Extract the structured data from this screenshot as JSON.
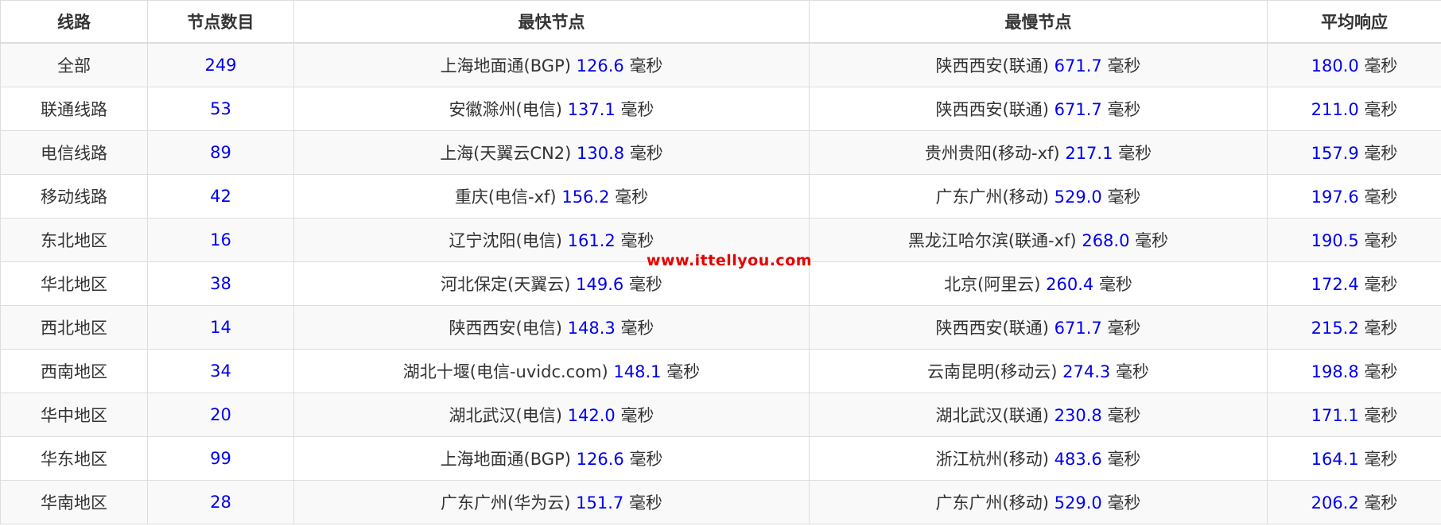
{
  "colors": {
    "value_blue": "#0000ee",
    "text": "#333333",
    "watermark_red": "#e60000",
    "stripe": "#f9f9f9"
  },
  "headers": [
    "线路",
    "节点数目",
    "最快节点",
    "最慢节点",
    "平均响应"
  ],
  "unit": "毫秒",
  "watermark": "www.ittellyou.com",
  "rows": [
    {
      "route": "全部",
      "count": "249",
      "fastest_node": "上海地面通(BGP)",
      "fastest_ms": "126.6",
      "slowest_node": "陕西西安(联通)",
      "slowest_ms": "671.7",
      "avg_ms": "180.0"
    },
    {
      "route": "联通线路",
      "count": "53",
      "fastest_node": "安徽滁州(电信)",
      "fastest_ms": "137.1",
      "slowest_node": "陕西西安(联通)",
      "slowest_ms": "671.7",
      "avg_ms": "211.0"
    },
    {
      "route": "电信线路",
      "count": "89",
      "fastest_node": "上海(天翼云CN2)",
      "fastest_ms": "130.8",
      "slowest_node": "贵州贵阳(移动-xf)",
      "slowest_ms": "217.1",
      "avg_ms": "157.9"
    },
    {
      "route": "移动线路",
      "count": "42",
      "fastest_node": "重庆(电信-xf)",
      "fastest_ms": "156.2",
      "slowest_node": "广东广州(移动)",
      "slowest_ms": "529.0",
      "avg_ms": "197.6"
    },
    {
      "route": "东北地区",
      "count": "16",
      "fastest_node": "辽宁沈阳(电信)",
      "fastest_ms": "161.2",
      "slowest_node": "黑龙江哈尔滨(联通-xf)",
      "slowest_ms": "268.0",
      "avg_ms": "190.5"
    },
    {
      "route": "华北地区",
      "count": "38",
      "fastest_node": "河北保定(天翼云)",
      "fastest_ms": "149.6",
      "slowest_node": "北京(阿里云)",
      "slowest_ms": "260.4",
      "avg_ms": "172.4"
    },
    {
      "route": "西北地区",
      "count": "14",
      "fastest_node": "陕西西安(电信)",
      "fastest_ms": "148.3",
      "slowest_node": "陕西西安(联通)",
      "slowest_ms": "671.7",
      "avg_ms": "215.2"
    },
    {
      "route": "西南地区",
      "count": "34",
      "fastest_node": "湖北十堰(电信-uvidc.com)",
      "fastest_ms": "148.1",
      "slowest_node": "云南昆明(移动云)",
      "slowest_ms": "274.3",
      "avg_ms": "198.8"
    },
    {
      "route": "华中地区",
      "count": "20",
      "fastest_node": "湖北武汉(电信)",
      "fastest_ms": "142.0",
      "slowest_node": "湖北武汉(联通)",
      "slowest_ms": "230.8",
      "avg_ms": "171.1"
    },
    {
      "route": "华东地区",
      "count": "99",
      "fastest_node": "上海地面通(BGP)",
      "fastest_ms": "126.6",
      "slowest_node": "浙江杭州(移动)",
      "slowest_ms": "483.6",
      "avg_ms": "164.1"
    },
    {
      "route": "华南地区",
      "count": "28",
      "fastest_node": "广东广州(华为云)",
      "fastest_ms": "151.7",
      "slowest_node": "广东广州(移动)",
      "slowest_ms": "529.0",
      "avg_ms": "206.2"
    }
  ]
}
